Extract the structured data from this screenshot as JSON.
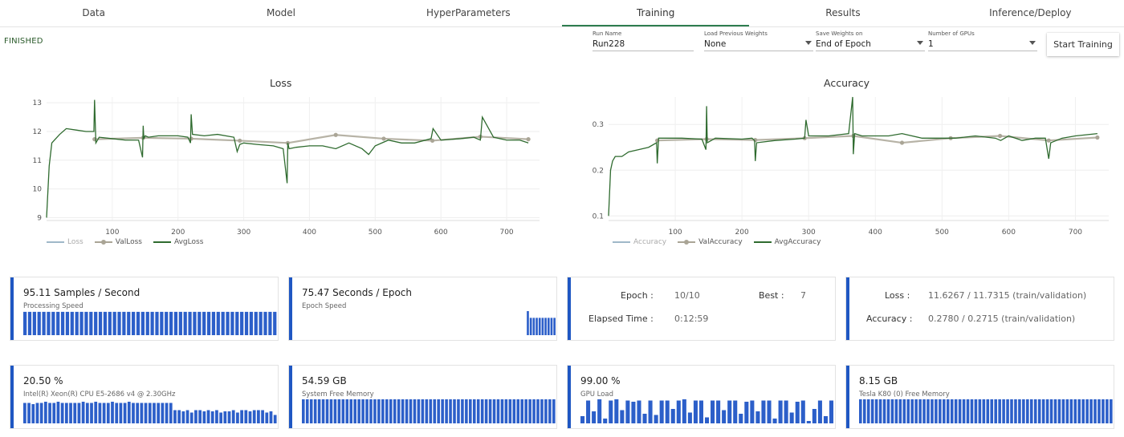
{
  "tabs": [
    {
      "label": "Data"
    },
    {
      "label": "Model"
    },
    {
      "label": "HyperParameters"
    },
    {
      "label": "Training",
      "active": true
    },
    {
      "label": "Results"
    },
    {
      "label": "Inference/Deploy"
    }
  ],
  "status": "FINISHED",
  "controls": {
    "run_name": {
      "label": "Run Name",
      "value": "Run228"
    },
    "load_weights": {
      "label": "Load Previous Weights",
      "value": "None"
    },
    "save_weights": {
      "label": "Save Weights on",
      "value": "End of Epoch"
    },
    "gpus": {
      "label": "Number of GPUs",
      "value": "1"
    },
    "start_button": "Start Training"
  },
  "colors": {
    "accent": "#2e7d4f",
    "series_main": "#2f6b2f",
    "series_val": "#aaa596",
    "series_raw": "#9fb8c8",
    "card_accent": "#1f57c3"
  },
  "chart_data": [
    {
      "type": "line",
      "title": "Loss",
      "xlim": [
        0,
        750
      ],
      "ylim": [
        8.9,
        13.2
      ],
      "xticks": [
        100,
        200,
        300,
        400,
        500,
        600,
        700
      ],
      "yticks": [
        9,
        10,
        11,
        12,
        13
      ],
      "legend": [
        "Loss",
        "ValLoss",
        "AvgLoss"
      ],
      "series": [
        {
          "name": "ValLoss",
          "x": [
            73,
            147,
            220,
            294,
            367,
            440,
            513,
            587,
            660,
            733
          ],
          "y": [
            11.73,
            11.78,
            11.75,
            11.68,
            11.6,
            11.88,
            11.75,
            11.68,
            11.82,
            11.73
          ]
        },
        {
          "name": "AvgLoss",
          "x": [
            0,
            4,
            8,
            12,
            20,
            30,
            45,
            60,
            72,
            73,
            75,
            80,
            100,
            120,
            140,
            146,
            147,
            148,
            150,
            155,
            170,
            200,
            215,
            219,
            220,
            222,
            240,
            260,
            285,
            290,
            294,
            300,
            320,
            345,
            360,
            366,
            367,
            369,
            380,
            400,
            420,
            440,
            460,
            480,
            490,
            500,
            520,
            540,
            560,
            585,
            588,
            600,
            630,
            650,
            660,
            663,
            680,
            700,
            720,
            733
          ],
          "y": [
            9.0,
            10.8,
            11.6,
            11.7,
            11.9,
            12.1,
            12.05,
            12.0,
            12.0,
            13.1,
            11.6,
            11.8,
            11.75,
            11.7,
            11.7,
            11.1,
            12.2,
            11.75,
            11.85,
            11.8,
            11.85,
            11.85,
            11.8,
            11.6,
            12.6,
            11.9,
            11.85,
            11.9,
            11.8,
            11.3,
            11.55,
            11.6,
            11.55,
            11.5,
            11.4,
            10.2,
            11.6,
            11.4,
            11.45,
            11.5,
            11.5,
            11.4,
            11.6,
            11.4,
            11.2,
            11.5,
            11.7,
            11.6,
            11.6,
            11.75,
            12.1,
            11.7,
            11.75,
            11.8,
            11.7,
            12.5,
            11.8,
            11.7,
            11.7,
            11.6
          ]
        }
      ]
    },
    {
      "type": "line",
      "title": "Accuracy",
      "xlim": [
        0,
        750
      ],
      "ylim": [
        0.09,
        0.36
      ],
      "xticks": [
        100,
        200,
        300,
        400,
        500,
        600,
        700
      ],
      "yticks": [
        0.1,
        0.2,
        0.3
      ],
      "legend": [
        "Accuracy",
        "ValAccuracy",
        "AvgAccuracy"
      ],
      "series": [
        {
          "name": "ValAccuracy",
          "x": [
            73,
            147,
            220,
            294,
            367,
            440,
            513,
            587,
            660,
            733
          ],
          "y": [
            0.265,
            0.268,
            0.266,
            0.27,
            0.275,
            0.26,
            0.27,
            0.275,
            0.265,
            0.2715
          ]
        },
        {
          "name": "AvgAccuracy",
          "x": [
            0,
            3,
            6,
            10,
            20,
            30,
            45,
            60,
            72,
            73,
            75,
            90,
            110,
            140,
            146,
            147,
            148,
            160,
            200,
            215,
            219,
            220,
            222,
            250,
            280,
            294,
            296,
            300,
            330,
            360,
            366,
            367,
            369,
            380,
            420,
            440,
            470,
            500,
            520,
            550,
            580,
            588,
            600,
            620,
            640,
            655,
            660,
            663,
            680,
            700,
            733
          ],
          "y": [
            0.1,
            0.2,
            0.22,
            0.23,
            0.23,
            0.24,
            0.245,
            0.25,
            0.26,
            0.215,
            0.27,
            0.27,
            0.27,
            0.268,
            0.245,
            0.34,
            0.26,
            0.27,
            0.268,
            0.27,
            0.265,
            0.22,
            0.26,
            0.265,
            0.268,
            0.27,
            0.31,
            0.275,
            0.275,
            0.28,
            0.36,
            0.235,
            0.28,
            0.275,
            0.275,
            0.28,
            0.27,
            0.27,
            0.27,
            0.275,
            0.27,
            0.265,
            0.275,
            0.265,
            0.27,
            0.27,
            0.225,
            0.26,
            0.27,
            0.275,
            0.28
          ]
        }
      ]
    }
  ],
  "cards": {
    "speed": {
      "value": "95.11 Samples / Second",
      "label": "Processing Speed",
      "bars": [
        0.97,
        0.97,
        0.97,
        0.97,
        0.97,
        0.97,
        0.97,
        0.97,
        0.97,
        0.97,
        0.97,
        0.97,
        0.97,
        0.97,
        0.97,
        0.97,
        0.97,
        0.97,
        0.97,
        0.97,
        0.97,
        0.97,
        0.97,
        0.97,
        0.97,
        0.97,
        0.97,
        0.97,
        0.97,
        0.97,
        0.97,
        0.97,
        0.97,
        0.97,
        0.97,
        0.97,
        0.97,
        0.97,
        0.97,
        0.97,
        0.97,
        0.97,
        0.97,
        0.97,
        0.97,
        0.97,
        0.97,
        0.97,
        0.97,
        0.97,
        0.97,
        0.97,
        0.97,
        0.97
      ]
    },
    "epoch_speed": {
      "value": "75.47 Seconds / Epoch",
      "label": "Epoch Speed",
      "bars": [
        0,
        0,
        0,
        0,
        0,
        0,
        0,
        0,
        0,
        0,
        0,
        0,
        0,
        0,
        0,
        0,
        0,
        0,
        0,
        0,
        0,
        0,
        0,
        0,
        0,
        0,
        0,
        0,
        0,
        0,
        0,
        0,
        0,
        0,
        0,
        0,
        0,
        0,
        0,
        0,
        0,
        0,
        0,
        0,
        0,
        0,
        0,
        0,
        0,
        0,
        0,
        0,
        0,
        0,
        0,
        0,
        0,
        0,
        0,
        0,
        0,
        0,
        0,
        0,
        0,
        0,
        0,
        0,
        0,
        0,
        0,
        0,
        0,
        0,
        0,
        0,
        1.0,
        0.72,
        0.72,
        0.72,
        0.72,
        0.72,
        0.72,
        0.72,
        0.72,
        0.72
      ]
    },
    "epoch": {
      "epoch_label": "Epoch :",
      "epoch_value": "10/10",
      "best_label": "Best :",
      "best_value": "7",
      "elapsed_label": "Elapsed Time :",
      "elapsed_value": "0:12:59"
    },
    "metrics": {
      "loss_label": "Loss :",
      "loss_value": "11.6267 / 11.7315 (train/validation)",
      "acc_label": "Accuracy :",
      "acc_value": "0.2780 / 0.2715 (train/validation)"
    },
    "cpu": {
      "value": "20.50 %",
      "label": "Intel(R) Xeon(R) CPU E5-2686 v4 @ 2.30GHz",
      "bars": [
        0.85,
        0.85,
        0.8,
        0.85,
        0.85,
        0.9,
        0.85,
        0.85,
        0.9,
        0.85,
        0.85,
        0.85,
        0.85,
        0.85,
        0.9,
        0.85,
        0.85,
        0.9,
        0.85,
        0.85,
        0.85,
        0.9,
        0.85,
        0.85,
        0.85,
        0.9,
        0.85,
        0.85,
        0.85,
        0.85,
        0.85,
        0.85,
        0.85,
        0.85,
        0.85,
        0.85,
        0.55,
        0.55,
        0.5,
        0.55,
        0.45,
        0.55,
        0.55,
        0.5,
        0.55,
        0.5,
        0.55,
        0.45,
        0.5,
        0.5,
        0.55,
        0.45,
        0.55,
        0.55,
        0.5,
        0.55,
        0.55,
        0.55,
        0.45,
        0.5,
        0.35
      ]
    },
    "memory": {
      "value": "54.59 GB",
      "label": "System Free Memory",
      "bars": [
        1,
        1,
        1,
        1,
        1,
        1,
        1,
        1,
        1,
        1,
        1,
        1,
        1,
        1,
        1,
        1,
        1,
        1,
        1,
        1,
        1,
        1,
        1,
        1,
        1,
        1,
        1,
        1,
        1,
        1,
        1,
        1,
        1,
        1,
        1,
        1,
        1,
        1,
        1,
        1,
        1,
        1,
        1,
        1,
        1,
        1,
        1,
        1,
        1,
        1,
        1,
        1,
        1,
        1,
        1,
        1,
        1,
        1,
        1,
        1,
        1,
        1,
        1,
        1
      ]
    },
    "gpu": {
      "value": "99.00 %",
      "label": "GPU Load",
      "bars": [
        0.3,
        0.95,
        0.5,
        1.0,
        0.2,
        0.95,
        1.0,
        0.55,
        0.95,
        0.9,
        0.95,
        0.4,
        0.95,
        0.35,
        0.95,
        0.95,
        0.6,
        0.95,
        1.0,
        0.45,
        0.95,
        0.95,
        0.25,
        0.95,
        0.95,
        0.55,
        0.95,
        0.95,
        0.4,
        0.9,
        0.95,
        0.5,
        0.95,
        0.95,
        0.2,
        0.95,
        0.95,
        0.45,
        0.9,
        0.95,
        0.1,
        0.6,
        0.95,
        0.3,
        0.95
      ]
    },
    "gpu_mem": {
      "value": "8.15 GB",
      "label": "Tesla K80 (0) Free Memory",
      "bars": [
        1,
        1,
        1,
        1,
        1,
        1,
        1,
        1,
        1,
        1,
        1,
        1,
        1,
        1,
        1,
        1,
        1,
        1,
        1,
        1,
        1,
        1,
        1,
        1,
        1,
        1,
        1,
        1,
        1,
        1,
        1,
        1,
        1,
        1,
        1,
        1,
        1,
        1,
        1,
        1,
        1,
        1,
        1,
        1,
        1,
        1,
        1,
        1,
        1,
        1,
        1,
        1,
        1,
        1,
        1,
        1,
        1,
        1,
        1,
        1,
        1,
        1,
        1,
        1
      ]
    }
  }
}
